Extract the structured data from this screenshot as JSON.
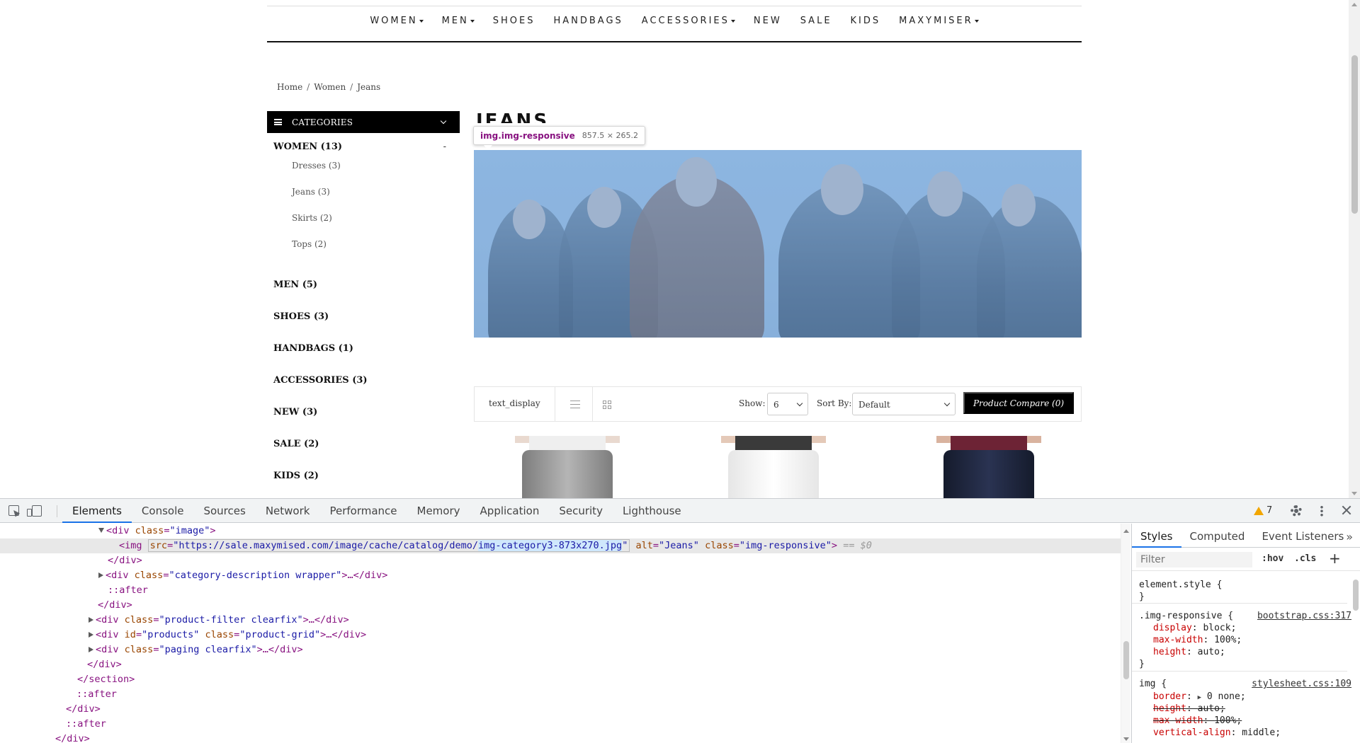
{
  "nav": {
    "items": [
      {
        "label": "WOMEN",
        "dropdown": true
      },
      {
        "label": "MEN",
        "dropdown": true
      },
      {
        "label": "SHOES",
        "dropdown": false
      },
      {
        "label": "HANDBAGS",
        "dropdown": false
      },
      {
        "label": "ACCESSORIES",
        "dropdown": true
      },
      {
        "label": "NEW",
        "dropdown": false
      },
      {
        "label": "SALE",
        "dropdown": false
      },
      {
        "label": "KIDS",
        "dropdown": false
      },
      {
        "label": "MAXYMISER",
        "dropdown": true
      }
    ]
  },
  "breadcrumb": {
    "items": [
      "Home",
      "Women",
      "Jeans"
    ],
    "separator": "/"
  },
  "categories": {
    "header": "CATEGORIES",
    "women": {
      "label": "WOMEN (13)",
      "toggle": "-",
      "children": [
        "Dresses (3)",
        "Jeans (3)",
        "Skirts (2)",
        "Tops (2)"
      ]
    },
    "others": [
      "MEN (5)",
      "SHOES (3)",
      "HANDBAGS (1)",
      "ACCESSORIES (3)",
      "NEW (3)",
      "SALE (2)",
      "KIDS (2)"
    ]
  },
  "page": {
    "title": "JEANS"
  },
  "tooltip": {
    "selector": "img.img-responsive",
    "dims": "857.5 × 265.2"
  },
  "toolbar": {
    "text_display": "text_display",
    "show_label": "Show:",
    "show_value": "6",
    "sort_label": "Sort By:",
    "sort_value": "Default",
    "compare_label": "Product Compare (0)"
  },
  "devtools": {
    "tabs": [
      "Elements",
      "Console",
      "Sources",
      "Network",
      "Performance",
      "Memory",
      "Application",
      "Security",
      "Lighthouse"
    ],
    "active_tab": "Elements",
    "warning_count": "7",
    "dom": {
      "l1": {
        "tag": "div",
        "class": "image"
      },
      "l2": {
        "src_prefix": "https://sale.maxymised.com/image/cache/catalog/demo/",
        "src_file": "img-category3-873x270.jpg",
        "alt": "Jeans",
        "class": "img-responsive",
        "eq": "== $0"
      },
      "l3": "</div>",
      "l4": {
        "tag": "div",
        "class": "category-description wrapper"
      },
      "l5": "::after",
      "l6": "</div>",
      "l7": {
        "tag": "div",
        "class": "product-filter clearfix"
      },
      "l8": {
        "tag": "div",
        "id": "products",
        "class": "product-grid"
      },
      "l9": {
        "tag": "div",
        "class": "paging clearfix"
      },
      "l10": "</div>",
      "l11": "</section>",
      "l12": "::after",
      "l13": "</div>",
      "l14": "::after",
      "l15": "</div>"
    },
    "styles": {
      "tabs": [
        "Styles",
        "Computed",
        "Event Listeners"
      ],
      "filter_placeholder": "Filter",
      "hov": ":hov",
      "cls": ".cls",
      "element_style": "element.style {",
      "close_brace": "}",
      "rule1": {
        "selector": ".img-responsive {",
        "source": "bootstrap.css:317",
        "props": [
          [
            "display",
            "block;"
          ],
          [
            "max-width",
            "100%;"
          ],
          [
            "height",
            "auto;"
          ]
        ]
      },
      "rule2": {
        "selector": "img {",
        "source": "stylesheet.css:109",
        "props": [
          [
            "border",
            "0 none;"
          ],
          [
            "height",
            "auto;"
          ],
          [
            "max-width",
            "100%;"
          ],
          [
            "vertical-align",
            "middle;"
          ]
        ]
      }
    }
  },
  "colors": {
    "accent": "#1a73e8",
    "tag": "#881280",
    "attr_name": "#994500",
    "attr_value": "#1a1aa6",
    "css_prop": "#c80000",
    "banner_highlight": "#9dbde3"
  }
}
